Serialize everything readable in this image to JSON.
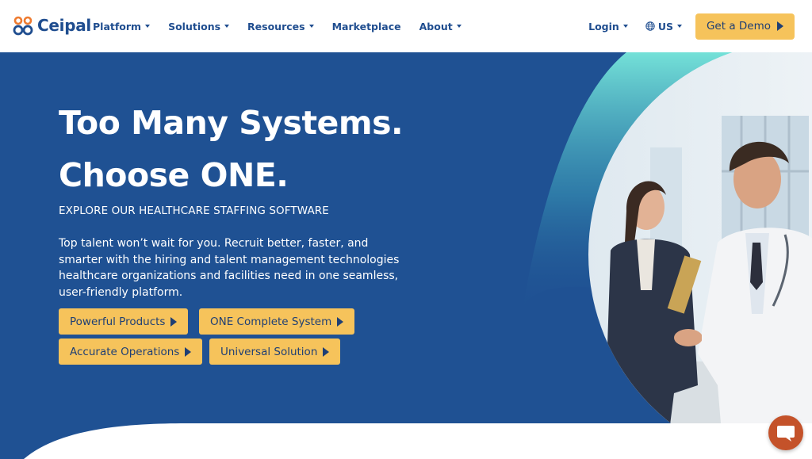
{
  "brand": {
    "name": "Ceipal",
    "logo_icon": "ceipal-rings-icon"
  },
  "nav": {
    "items": [
      {
        "label": "Platform",
        "dropdown": true
      },
      {
        "label": "Solutions",
        "dropdown": true
      },
      {
        "label": "Resources",
        "dropdown": true
      },
      {
        "label": "Marketplace",
        "dropdown": false
      },
      {
        "label": "About",
        "dropdown": true
      }
    ],
    "login_label": "Login",
    "region_label": "US",
    "demo_label": "Get a Demo"
  },
  "hero": {
    "headline_line1": "Too Many Systems.",
    "headline_line2": "Choose ONE.",
    "eyebrow": "EXPLORE OUR HEALTHCARE STAFFING SOFTWARE",
    "body": "Top talent won’t wait for you. Recruit better, faster, and smarter with the hiring and talent management technologies healthcare organizations and facilities need in one seamless, user-friendly platform.",
    "buttons": [
      {
        "label": "Powerful Products"
      },
      {
        "label": "ONE Complete System"
      },
      {
        "label": "Accurate Operations"
      },
      {
        "label": "Universal Solution"
      }
    ]
  },
  "chat": {
    "icon": "chat-bubble-icon"
  },
  "colors": {
    "brand_blue": "#1f4d8f",
    "hero_blue": "#1f5193",
    "teal_accent": "#72ded6",
    "button_yellow": "#f6c35b",
    "logo_orange": "#ee7b30",
    "chat_orange": "#c4522a"
  }
}
